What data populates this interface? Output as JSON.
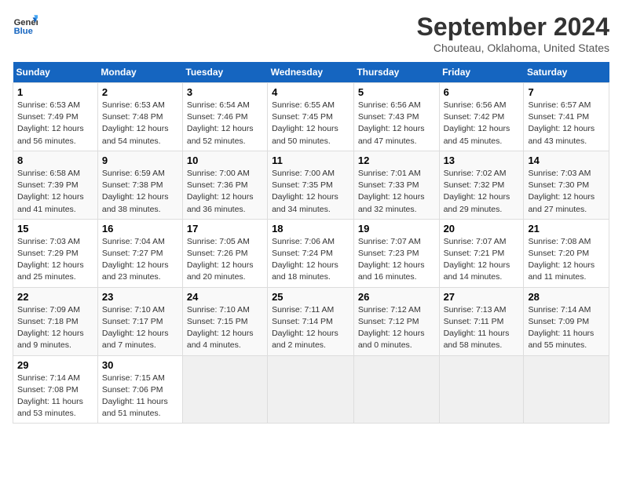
{
  "logo": {
    "line1": "General",
    "line2": "Blue"
  },
  "title": "September 2024",
  "subtitle": "Chouteau, Oklahoma, United States",
  "weekdays": [
    "Sunday",
    "Monday",
    "Tuesday",
    "Wednesday",
    "Thursday",
    "Friday",
    "Saturday"
  ],
  "weeks": [
    [
      {
        "day": "1",
        "sunrise": "6:53 AM",
        "sunset": "7:49 PM",
        "daylight": "12 hours and 56 minutes."
      },
      {
        "day": "2",
        "sunrise": "6:53 AM",
        "sunset": "7:48 PM",
        "daylight": "12 hours and 54 minutes."
      },
      {
        "day": "3",
        "sunrise": "6:54 AM",
        "sunset": "7:46 PM",
        "daylight": "12 hours and 52 minutes."
      },
      {
        "day": "4",
        "sunrise": "6:55 AM",
        "sunset": "7:45 PM",
        "daylight": "12 hours and 50 minutes."
      },
      {
        "day": "5",
        "sunrise": "6:56 AM",
        "sunset": "7:43 PM",
        "daylight": "12 hours and 47 minutes."
      },
      {
        "day": "6",
        "sunrise": "6:56 AM",
        "sunset": "7:42 PM",
        "daylight": "12 hours and 45 minutes."
      },
      {
        "day": "7",
        "sunrise": "6:57 AM",
        "sunset": "7:41 PM",
        "daylight": "12 hours and 43 minutes."
      }
    ],
    [
      {
        "day": "8",
        "sunrise": "6:58 AM",
        "sunset": "7:39 PM",
        "daylight": "12 hours and 41 minutes."
      },
      {
        "day": "9",
        "sunrise": "6:59 AM",
        "sunset": "7:38 PM",
        "daylight": "12 hours and 38 minutes."
      },
      {
        "day": "10",
        "sunrise": "7:00 AM",
        "sunset": "7:36 PM",
        "daylight": "12 hours and 36 minutes."
      },
      {
        "day": "11",
        "sunrise": "7:00 AM",
        "sunset": "7:35 PM",
        "daylight": "12 hours and 34 minutes."
      },
      {
        "day": "12",
        "sunrise": "7:01 AM",
        "sunset": "7:33 PM",
        "daylight": "12 hours and 32 minutes."
      },
      {
        "day": "13",
        "sunrise": "7:02 AM",
        "sunset": "7:32 PM",
        "daylight": "12 hours and 29 minutes."
      },
      {
        "day": "14",
        "sunrise": "7:03 AM",
        "sunset": "7:30 PM",
        "daylight": "12 hours and 27 minutes."
      }
    ],
    [
      {
        "day": "15",
        "sunrise": "7:03 AM",
        "sunset": "7:29 PM",
        "daylight": "12 hours and 25 minutes."
      },
      {
        "day": "16",
        "sunrise": "7:04 AM",
        "sunset": "7:27 PM",
        "daylight": "12 hours and 23 minutes."
      },
      {
        "day": "17",
        "sunrise": "7:05 AM",
        "sunset": "7:26 PM",
        "daylight": "12 hours and 20 minutes."
      },
      {
        "day": "18",
        "sunrise": "7:06 AM",
        "sunset": "7:24 PM",
        "daylight": "12 hours and 18 minutes."
      },
      {
        "day": "19",
        "sunrise": "7:07 AM",
        "sunset": "7:23 PM",
        "daylight": "12 hours and 16 minutes."
      },
      {
        "day": "20",
        "sunrise": "7:07 AM",
        "sunset": "7:21 PM",
        "daylight": "12 hours and 14 minutes."
      },
      {
        "day": "21",
        "sunrise": "7:08 AM",
        "sunset": "7:20 PM",
        "daylight": "12 hours and 11 minutes."
      }
    ],
    [
      {
        "day": "22",
        "sunrise": "7:09 AM",
        "sunset": "7:18 PM",
        "daylight": "12 hours and 9 minutes."
      },
      {
        "day": "23",
        "sunrise": "7:10 AM",
        "sunset": "7:17 PM",
        "daylight": "12 hours and 7 minutes."
      },
      {
        "day": "24",
        "sunrise": "7:10 AM",
        "sunset": "7:15 PM",
        "daylight": "12 hours and 4 minutes."
      },
      {
        "day": "25",
        "sunrise": "7:11 AM",
        "sunset": "7:14 PM",
        "daylight": "12 hours and 2 minutes."
      },
      {
        "day": "26",
        "sunrise": "7:12 AM",
        "sunset": "7:12 PM",
        "daylight": "12 hours and 0 minutes."
      },
      {
        "day": "27",
        "sunrise": "7:13 AM",
        "sunset": "7:11 PM",
        "daylight": "11 hours and 58 minutes."
      },
      {
        "day": "28",
        "sunrise": "7:14 AM",
        "sunset": "7:09 PM",
        "daylight": "11 hours and 55 minutes."
      }
    ],
    [
      {
        "day": "29",
        "sunrise": "7:14 AM",
        "sunset": "7:08 PM",
        "daylight": "11 hours and 53 minutes."
      },
      {
        "day": "30",
        "sunrise": "7:15 AM",
        "sunset": "7:06 PM",
        "daylight": "11 hours and 51 minutes."
      },
      null,
      null,
      null,
      null,
      null
    ]
  ]
}
